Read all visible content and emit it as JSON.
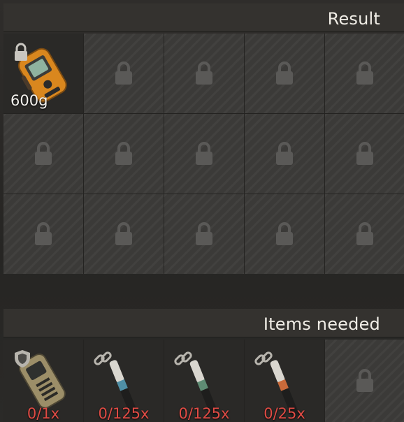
{
  "result": {
    "title": "Result",
    "slots": [
      {
        "filled": true,
        "item_icon": "orange-detector-device",
        "corner_icon": "lock-icon",
        "quantity": "600g"
      },
      {
        "filled": false
      },
      {
        "filled": false
      },
      {
        "filled": false
      },
      {
        "filled": false
      },
      {
        "filled": false
      },
      {
        "filled": false
      },
      {
        "filled": false
      },
      {
        "filled": false
      },
      {
        "filled": false
      },
      {
        "filled": false
      },
      {
        "filled": false
      },
      {
        "filled": false
      },
      {
        "filled": false
      },
      {
        "filled": false
      }
    ]
  },
  "needed": {
    "title": "Items needed",
    "items": [
      {
        "item_icon": "khaki-handheld-device",
        "corner_icon": "shield-icon",
        "count": "0/1x"
      },
      {
        "item_icon": "cable-blue",
        "corner_icon": "link-icon",
        "count": "0/125x"
      },
      {
        "item_icon": "cable-green",
        "corner_icon": "link-icon",
        "count": "0/125x"
      },
      {
        "item_icon": "cable-orange",
        "corner_icon": "link-icon",
        "count": "0/25x"
      },
      {
        "item_icon": "lock-icon",
        "locked": true
      }
    ]
  },
  "colors": {
    "missing_count": "#e04b44",
    "slot_bg": "#3b3a38",
    "header_bg": "#34322f",
    "cable_blue": "#4f8fa6",
    "cable_green": "#5f8c74",
    "cable_orange": "#c96a3a"
  }
}
